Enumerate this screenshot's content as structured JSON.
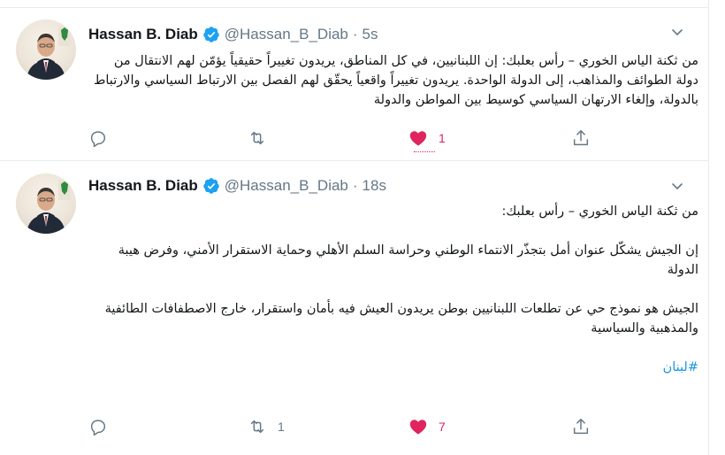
{
  "colors": {
    "accent": "#1da1f2",
    "like": "#e0245e",
    "muted": "#657786",
    "hashtag": "#1b95e0"
  },
  "tweets": [
    {
      "author_name": "Hassan B. Diab",
      "handle": "@Hassan_B_Diab",
      "separator": "·",
      "time": "5s",
      "paragraphs": [
        "من ثكنة الياس الخوري – رأس بعلبك: إن اللبنانيين، في كل المناطق، يريدون تغييراً حقيقياً يؤمّن لهم الانتقال من دولة الطوائف والمذاهب، إلى الدولة الواحدة. يريدون تغييراً واقعياً يحقّق لهم الفصل بين الارتباط السياسي والارتباط بالدولة، وإلغاء الارتهان السياسي كوسيط بين المواطن والدولة"
      ],
      "hashtag": "",
      "replies": "",
      "retweets": "",
      "likes": "1",
      "liked": true
    },
    {
      "author_name": "Hassan B. Diab",
      "handle": "@Hassan_B_Diab",
      "separator": "·",
      "time": "18s",
      "paragraphs": [
        "من ثكنة الياس الخوري – رأس بعلبك:",
        "إن الجيش يشكّل عنوان أمل بتجذّر الانتماء الوطني وحراسة السلم الأهلي وحماية الاستقرار الأمني، وفرض هيبة الدولة",
        "الجيش هو نموذج حي عن تطلعات اللبنانيين بوطن يريدون العيش فيه بأمان واستقرار، خارج الاصطفافات الطائفية والمذهبية والسياسية"
      ],
      "hashtag": "#لبنان",
      "replies": "",
      "retweets": "1",
      "likes": "7",
      "liked": true
    }
  ],
  "icons": {
    "verified": "verified-badge-icon",
    "more": "chevron-down-icon",
    "reply": "reply-icon",
    "retweet": "retweet-icon",
    "like": "heart-icon",
    "share": "share-icon"
  }
}
